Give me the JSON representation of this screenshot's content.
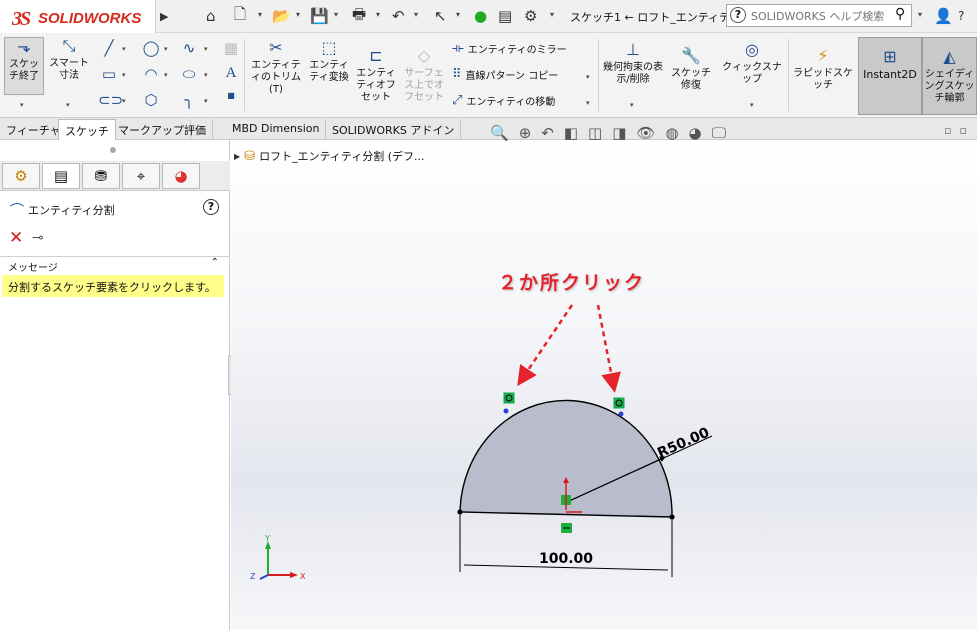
{
  "app": {
    "name": "SOLIDWORKS",
    "logo_mark": "3S"
  },
  "titlebar": {
    "doc_title": "スケッチ1 ← ロフト_エンティティ...",
    "help_search": {
      "placeholder": "SOLIDWORKS ヘルプ検索"
    },
    "icons": [
      "home-icon",
      "new-document-icon",
      "open-icon",
      "save-icon",
      "print-icon",
      "undo-icon",
      "select-icon",
      "traffic-light-icon",
      "file-properties-icon",
      "options-gear-icon",
      "user-icon",
      "help-icon"
    ]
  },
  "commandmanager": {
    "exit_sketch": "スケッチ終了",
    "smart_dimension": "スマート寸法",
    "trim_entities": "エンティティのトリム(T)",
    "convert_entities": "エンティティ変換",
    "offset_entities": "エンティティオフセット",
    "surface_offset": "サーフェス上でオフセット",
    "mirror_entities": "エンティティのミラー",
    "linear_pattern": "直線パターン コピー",
    "move_entities": "エンティティの移動",
    "display_delete_relations": "幾何拘束の表示/削除",
    "repair_sketch": "スケッチ修復",
    "quick_snaps": "クィックスナップ",
    "rapid_sketch": "ラピッドスケッチ",
    "instant2d": "Instant2D",
    "shaded_sketch_contours": "シェイディングスケッチ輪郭"
  },
  "tabs": [
    "フィーチャー",
    "スケッチ",
    "マークアップ",
    "評価",
    "MBD Dimension",
    "SOLIDWORKS アドイン"
  ],
  "active_tab": 1,
  "property_manager": {
    "title": "エンティティ分割",
    "help_icon": "?",
    "message_header": "メッセージ",
    "message": "分割するスケッチ要素をクリックします。",
    "tab_icons": [
      "featuremanager-icon",
      "propertymanager-icon",
      "configurationmanager-icon",
      "dimxpert-icon",
      "display-manager-icon"
    ]
  },
  "feature_tree": {
    "item": "ロフト_エンティティ分割 (デフ..."
  },
  "graphics": {
    "annotation": "２か所クリック",
    "dimension_radius": "R50.00",
    "dimension_linear": "100.00",
    "triad": {
      "x": "X",
      "y": "Y",
      "z": "Z"
    },
    "colors": {
      "sketch_fill": "#b9bccb",
      "annotation": "#e5232d",
      "relation_green": "#1fae3d"
    }
  }
}
